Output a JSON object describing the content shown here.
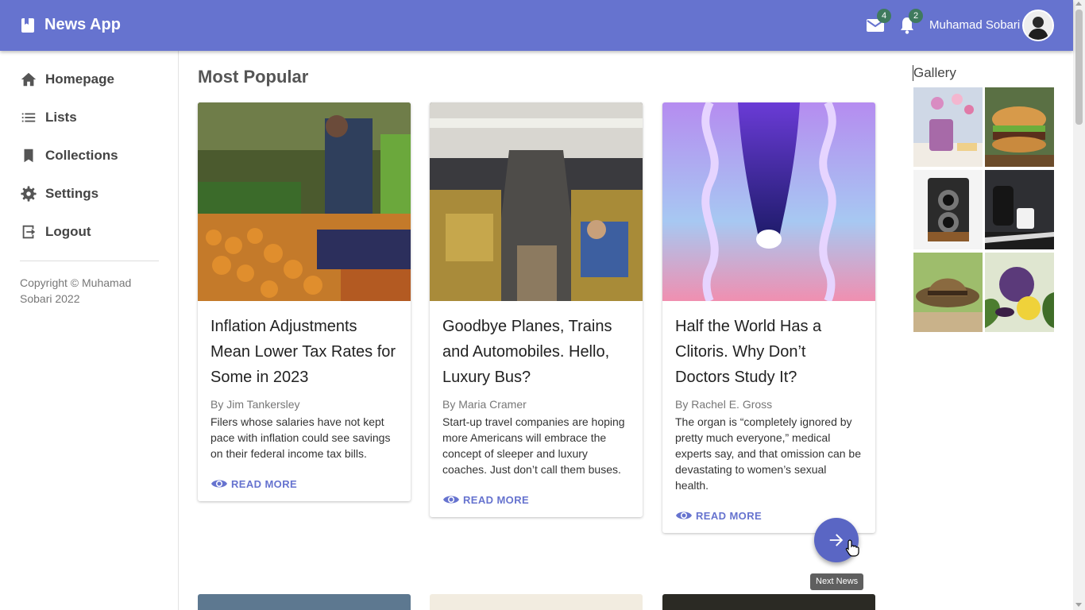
{
  "app": {
    "title": "News App",
    "brand_icon": "book-icon",
    "mail_badge": "4",
    "notification_badge": "2",
    "user_name": "Muhamad Sobari"
  },
  "sidebar": {
    "items": [
      {
        "label": "Homepage",
        "icon": "home-icon"
      },
      {
        "label": "Lists",
        "icon": "list-icon"
      },
      {
        "label": "Collections",
        "icon": "bookmark-icon"
      },
      {
        "label": "Settings",
        "icon": "gear-icon"
      },
      {
        "label": "Logout",
        "icon": "logout-icon"
      }
    ],
    "copyright": "Copyright © Muhamad Sobari 2022"
  },
  "main": {
    "section_title": "Most Popular",
    "cards": [
      {
        "title": "Inflation Adjustments Mean Lower Tax Rates for Some in 2023",
        "author": "By Jim Tankersley",
        "summary": "Filers whose salaries have not kept pace with inflation could see savings on their federal income tax bills.",
        "action": "READ MORE"
      },
      {
        "title": "Goodbye Planes, Trains and Automobiles. Hello, Luxury Bus?",
        "author": "By Maria Cramer",
        "summary": "Start-up travel companies are hoping more Americans will embrace the concept of sleeper and luxury coaches. Just don’t call them buses.",
        "action": "READ MORE"
      },
      {
        "title": "Half the World Has a Clitoris. Why Don’t Doctors Study It?",
        "author": "By Rachel E. Gross",
        "summary": "The organ is “completely ignored by pretty much everyone,” medical experts say, and that omission can be devastating to women’s sexual health.",
        "action": "READ MORE"
      }
    ],
    "fab_tooltip": "Next News"
  },
  "gallery": {
    "title": "Gallery"
  },
  "colors": {
    "primary": "#6673cf",
    "badge": "#3f7a5e"
  }
}
